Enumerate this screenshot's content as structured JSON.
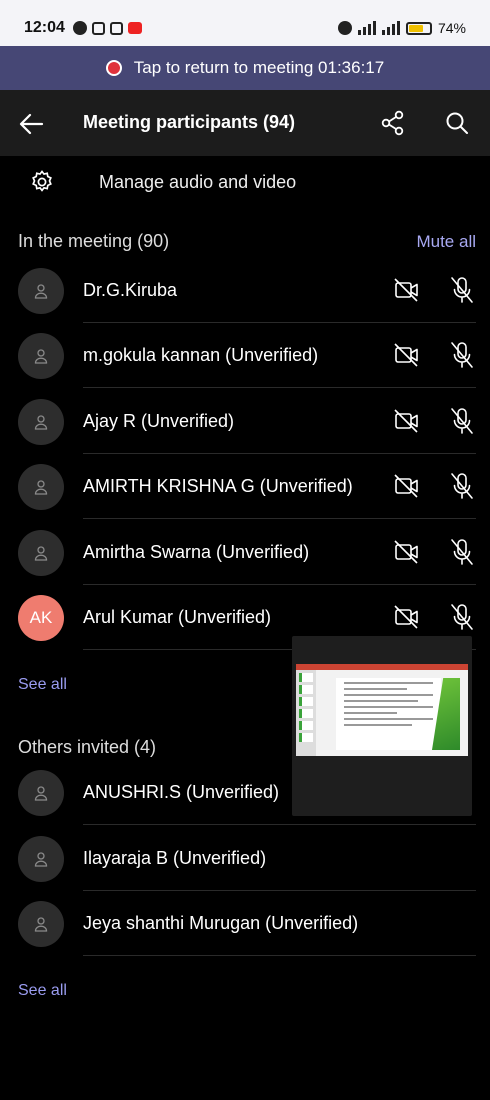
{
  "status_bar": {
    "time": "12:04",
    "battery_percent": "74%",
    "battery_level": 0.74
  },
  "banner": {
    "text": "Tap to return to meeting 01:36:17"
  },
  "header": {
    "title": "Meeting participants (94)"
  },
  "manage": {
    "label": "Manage audio and video"
  },
  "in_meeting": {
    "title": "In the meeting (90)",
    "mute_all": "Mute all",
    "participants": [
      {
        "name": "Dr.G.Kiruba",
        "initials": ""
      },
      {
        "name": "m.gokula kannan (Unverified)",
        "initials": ""
      },
      {
        "name": "Ajay R (Unverified)",
        "initials": ""
      },
      {
        "name": "AMIRTH KRISHNA G (Unverified)",
        "initials": ""
      },
      {
        "name": "Amirtha Swarna (Unverified)",
        "initials": ""
      },
      {
        "name": "Arul Kumar (Unverified)",
        "initials": "AK"
      }
    ],
    "see_all": "See all"
  },
  "others_invited": {
    "title": "Others invited (4)",
    "people": [
      {
        "name": "ANUSHRI.S (Unverified)"
      },
      {
        "name": "Ilayaraja B (Unverified)"
      },
      {
        "name": "Jeya shanthi Murugan (Unverified)"
      }
    ],
    "see_all": "See all"
  },
  "colors": {
    "accent": "#464775",
    "link": "#9a9cf0",
    "record": "#e0333c",
    "avatar_ak": "#ef7c6f"
  },
  "icons": [
    "back-arrow-icon",
    "share-icon",
    "search-icon",
    "gear-icon",
    "person-icon",
    "camera-off-icon",
    "mic-off-icon"
  ]
}
